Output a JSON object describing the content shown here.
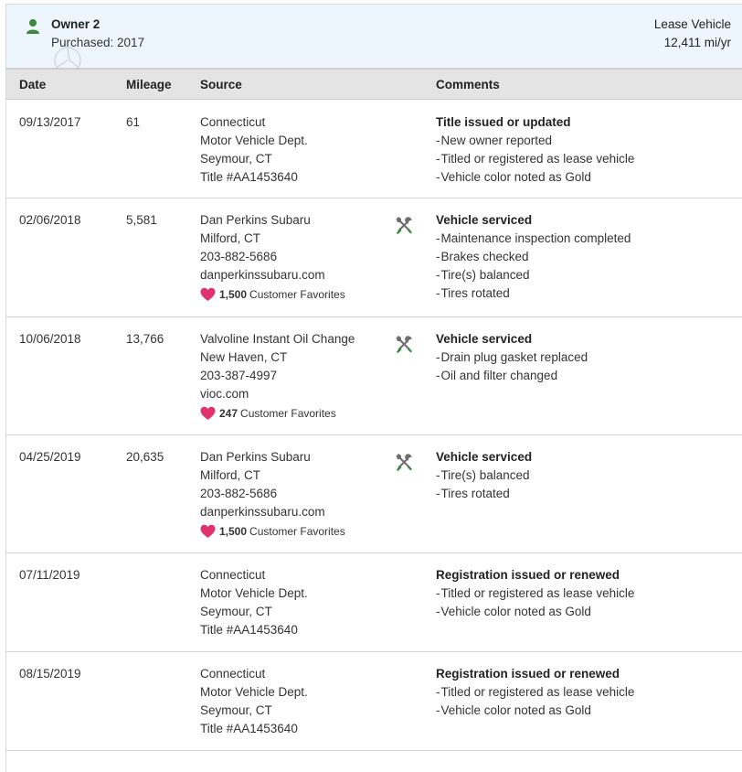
{
  "owner": {
    "name": "Owner 2",
    "purchased": "Purchased: 2017",
    "type": "Lease Vehicle",
    "rate": "12,411 mi/yr",
    "icon": "person-icon",
    "accent": "#3b8a3b"
  },
  "table": {
    "headers": {
      "date": "Date",
      "mileage": "Mileage",
      "source": "Source",
      "comments": "Comments"
    },
    "rows": [
      {
        "date": "09/13/2017",
        "mileage": "61",
        "source": [
          "Connecticut",
          "Motor Vehicle Dept.",
          "Seymour, CT",
          "Title #AA1453640"
        ],
        "favorites": null,
        "service_icon": false,
        "comment_title": "Title issued or updated",
        "comment_items": [
          "New owner reported",
          "Titled or registered as lease vehicle",
          "Vehicle color noted as Gold"
        ]
      },
      {
        "date": "02/06/2018",
        "mileage": "5,581",
        "source": [
          "Dan Perkins Subaru",
          "Milford, CT",
          "203-882-5686",
          "danperkinssubaru.com"
        ],
        "favorites": {
          "count": "1,500",
          "label": "Customer Favorites"
        },
        "service_icon": true,
        "comment_title": "Vehicle serviced",
        "comment_items": [
          "Maintenance inspection completed",
          "Brakes checked",
          "Tire(s) balanced",
          "Tires rotated"
        ]
      },
      {
        "date": "10/06/2018",
        "mileage": "13,766",
        "source": [
          "Valvoline Instant Oil Change",
          "New Haven, CT",
          "203-387-4997",
          "vioc.com"
        ],
        "favorites": {
          "count": "247",
          "label": "Customer Favorites"
        },
        "service_icon": true,
        "comment_title": "Vehicle serviced",
        "comment_items": [
          "Drain plug gasket replaced",
          "Oil and filter changed"
        ]
      },
      {
        "date": "04/25/2019",
        "mileage": "20,635",
        "source": [
          "Dan Perkins Subaru",
          "Milford, CT",
          "203-882-5686",
          "danperkinssubaru.com"
        ],
        "favorites": {
          "count": "1,500",
          "label": "Customer Favorites"
        },
        "service_icon": true,
        "comment_title": "Vehicle serviced",
        "comment_items": [
          "Tire(s) balanced",
          "Tires rotated"
        ]
      },
      {
        "date": "07/11/2019",
        "mileage": "",
        "source": [
          "Connecticut",
          "Motor Vehicle Dept.",
          "Seymour, CT",
          "Title #AA1453640"
        ],
        "favorites": null,
        "service_icon": false,
        "comment_title": "Registration issued or renewed",
        "comment_items": [
          "Titled or registered as lease vehicle",
          "Vehicle color noted as Gold"
        ]
      },
      {
        "date": "08/15/2019",
        "mileage": "",
        "source": [
          "Connecticut",
          "Motor Vehicle Dept.",
          "Seymour, CT",
          "Title #AA1453640"
        ],
        "favorites": null,
        "service_icon": false,
        "comment_title": "Registration issued or renewed",
        "comment_items": [
          "Titled or registered as lease vehicle",
          "Vehicle color noted as Gold"
        ]
      }
    ]
  },
  "icons": {
    "service": "wrench-screwdriver-icon",
    "favorite": "heart-icon"
  },
  "colors": {
    "heart": "#e0336e",
    "tool_gray": "#6f6f6f",
    "tool_green": "#2e8b3a"
  }
}
